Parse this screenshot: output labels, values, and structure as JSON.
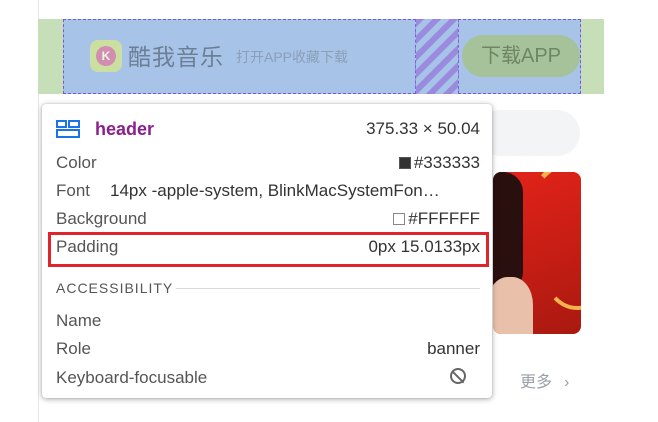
{
  "page": {
    "brand_name": "酷我音乐",
    "brand_tagline": "打开APP收藏下载",
    "logo_letter": "K",
    "download_button": "下载APP",
    "more_link": "更多",
    "more_chevron": "›"
  },
  "tooltip": {
    "element_tag": "header",
    "element_size": "375.33 × 50.04",
    "color_label": "Color",
    "color_value": "#333333",
    "color_swatch": "#333333",
    "font_label": "Font",
    "font_value": "14px -apple-system, BlinkMacSystemFon…",
    "background_label": "Background",
    "background_value": "#FFFFFF",
    "background_swatch": "#FFFFFF",
    "padding_label": "Padding",
    "padding_value": "0px 15.0133px",
    "accessibility_heading": "ACCESSIBILITY",
    "name_label": "Name",
    "name_value": "",
    "role_label": "Role",
    "role_value": "banner",
    "keyboard_label": "Keyboard-focusable",
    "keyboard_icon": "not-allowed-icon"
  },
  "colors": {
    "element_tag": "#8b1f8e",
    "highlight_border": "#e0242b",
    "margin_overlay": "#c6dfb8",
    "content_overlay": "#a8c3e8",
    "padding_overlay": "#9a86de"
  }
}
